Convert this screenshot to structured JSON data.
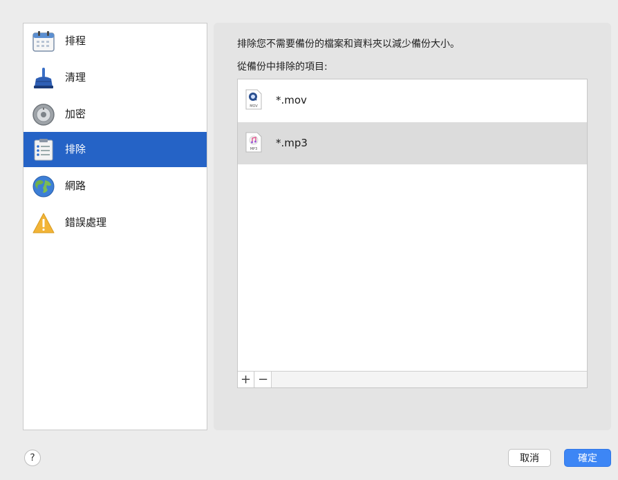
{
  "sidebar": {
    "items": [
      {
        "label": "排程",
        "icon": "calendar-icon"
      },
      {
        "label": "清理",
        "icon": "broom-icon"
      },
      {
        "label": "加密",
        "icon": "lock-dial-icon"
      },
      {
        "label": "排除",
        "icon": "clipboard-list-icon"
      },
      {
        "label": "網路",
        "icon": "globe-icon"
      },
      {
        "label": "錯誤處理",
        "icon": "warning-icon"
      }
    ],
    "selected_index": 3
  },
  "panel": {
    "description": "排除您不需要備份的檔案和資料夾以減少備份大小。",
    "list_title": "從備份中排除的項目:",
    "items": [
      {
        "name": "*.mov",
        "icon": "quicktime-file-icon",
        "badge": "MOV"
      },
      {
        "name": "*.mp3",
        "icon": "music-file-icon",
        "badge": "MP3"
      }
    ],
    "add_label": "+",
    "remove_label": "−"
  },
  "footer": {
    "help_label": "?",
    "cancel_label": "取消",
    "ok_label": "確定"
  },
  "colors": {
    "selection": "#2563c6",
    "primary_button": "#3d86f5",
    "panel_bg": "#e4e4e4",
    "window_bg": "#ececec"
  }
}
